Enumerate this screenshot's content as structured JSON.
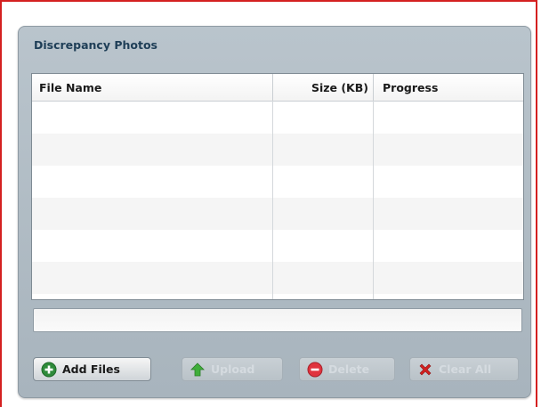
{
  "panel": {
    "title": "Discrepancy Photos"
  },
  "grid": {
    "columns": [
      "File Name",
      "Size (KB)",
      "Progress"
    ],
    "rows": [],
    "status_text": ""
  },
  "buttons": {
    "add_files": {
      "label": "Add Files",
      "enabled": true,
      "icon": "plus-circle-icon"
    },
    "upload": {
      "label": "Upload",
      "enabled": false,
      "icon": "arrow-up-icon"
    },
    "delete": {
      "label": "Delete",
      "enabled": false,
      "icon": "minus-circle-icon"
    },
    "clear_all": {
      "label": "Clear All",
      "enabled": false,
      "icon": "red-x-icon"
    }
  },
  "colors": {
    "frame_border": "#d42020",
    "panel_title": "#1e3e57",
    "panel_bg": "#b9c4cc",
    "add_icon": "#2e8b3a",
    "upload_icon": "#3fae3a",
    "delete_icon": "#e0333e",
    "clear_icon": "#d42020"
  }
}
